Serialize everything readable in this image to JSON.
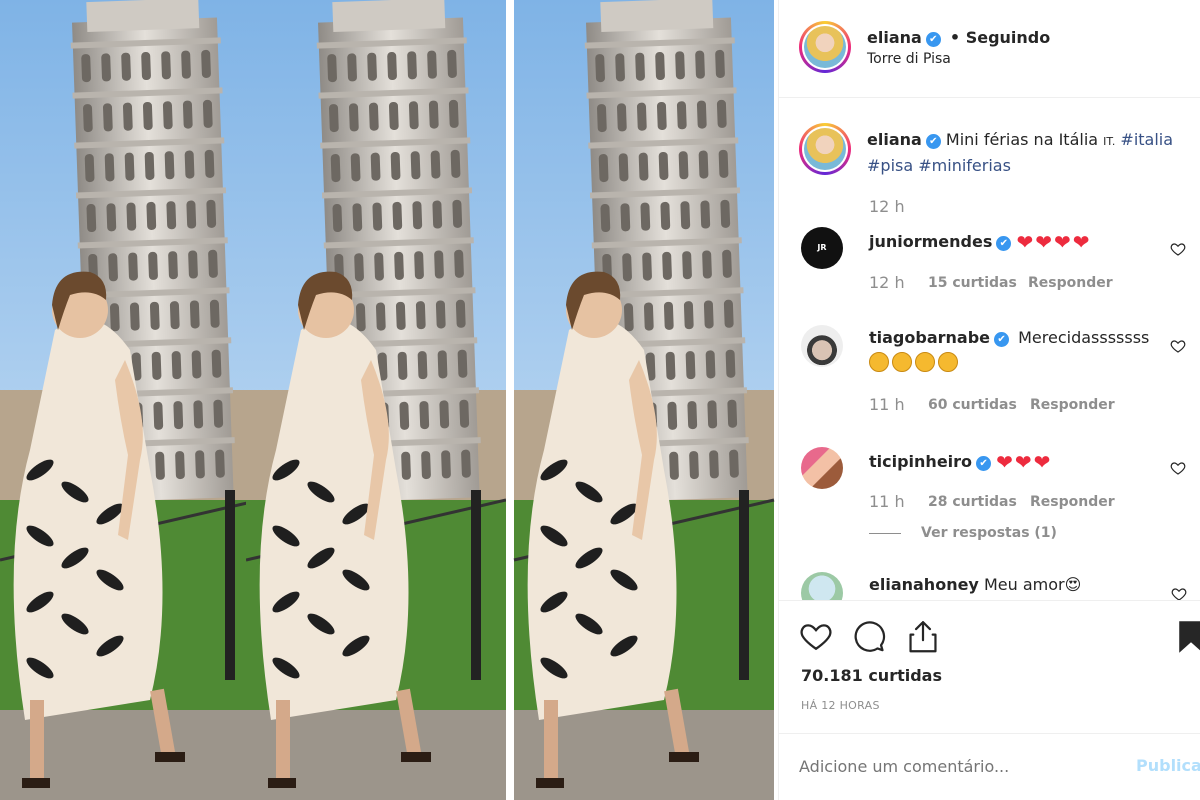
{
  "post": {
    "author": "eliana",
    "follow_status": "• Seguindo",
    "location": "Torre di Pisa",
    "caption_text": "Mini férias na Itália ",
    "caption_flag": "IT.",
    "hashtag_1": "#italia",
    "hashtag_2": "#pisa",
    "hashtag_3": "#miniferias",
    "caption_time": "12 h",
    "verified_mark": "✔"
  },
  "comments": [
    {
      "user": "juniormendes",
      "text": "",
      "emoji": "❤❤❤❤",
      "time": "12 h",
      "likes": "15 curtidas",
      "reply": "Responder",
      "avatar_text": "JR MENDES"
    },
    {
      "user": "tiagobarnabe",
      "text": "Merecidasssssss",
      "emoji": "",
      "time": "11 h",
      "likes": "60 curtidas",
      "reply": "Responder"
    },
    {
      "user": "ticipinheiro",
      "text": "",
      "emoji": "❤❤❤",
      "time": "11 h",
      "likes": "28 curtidas",
      "reply": "Responder",
      "view_replies": "Ver respostas (1)"
    },
    {
      "user": "elianahoney",
      "text": "Meu amor",
      "emoji": "😍"
    }
  ],
  "actions": {
    "likes_count": "70.181 curtidas",
    "timestamp": "HÁ 12 HORAS"
  },
  "comment_box": {
    "placeholder": "Adicione um comentário...",
    "publish": "Publicar"
  },
  "icons": [
    "verified-icon",
    "heart-icon",
    "comment-icon",
    "share-icon",
    "bookmark-icon",
    "clap-emoji"
  ],
  "colors": {
    "verified": "#3897f0",
    "link": "#385185",
    "muted": "#8e8e8e",
    "heart_red": "#ed2b3e",
    "publish": "#b2dffc"
  }
}
